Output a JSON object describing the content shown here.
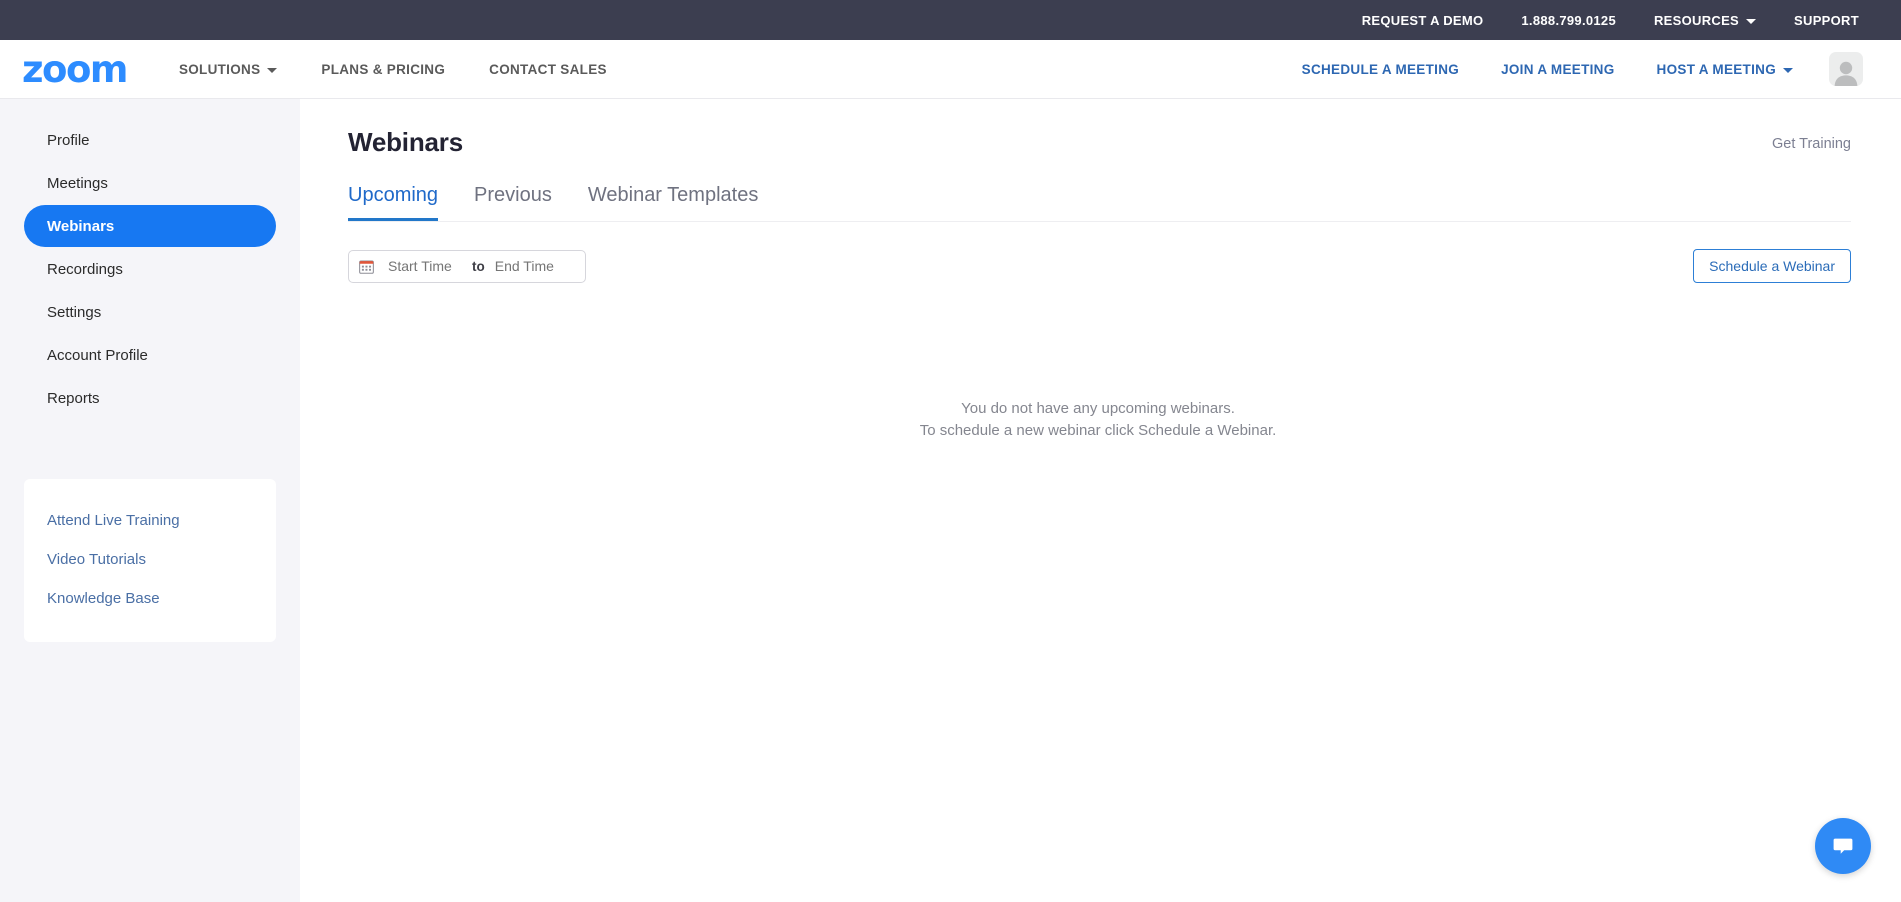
{
  "topbar": {
    "items": [
      {
        "label": "REQUEST A DEMO",
        "caret": false
      },
      {
        "label": "1.888.799.0125",
        "caret": false
      },
      {
        "label": "RESOURCES",
        "caret": true
      },
      {
        "label": "SUPPORT",
        "caret": false
      }
    ]
  },
  "mainnav": {
    "logo": "zoom",
    "left_items": [
      {
        "label": "SOLUTIONS",
        "caret": true
      },
      {
        "label": "PLANS & PRICING",
        "caret": false
      },
      {
        "label": "CONTACT SALES",
        "caret": false
      }
    ],
    "right_items": [
      {
        "label": "SCHEDULE A MEETING",
        "caret": false
      },
      {
        "label": "JOIN A MEETING",
        "caret": false
      },
      {
        "label": "HOST A MEETING",
        "caret": true
      }
    ],
    "avatar_name": "user-avatar"
  },
  "sidebar": {
    "items": [
      {
        "label": "Profile",
        "active": false
      },
      {
        "label": "Meetings",
        "active": false
      },
      {
        "label": "Webinars",
        "active": true
      },
      {
        "label": "Recordings",
        "active": false
      },
      {
        "label": "Settings",
        "active": false
      },
      {
        "label": "Account Profile",
        "active": false
      },
      {
        "label": "Reports",
        "active": false
      }
    ],
    "help_links": [
      {
        "label": "Attend Live Training"
      },
      {
        "label": "Video Tutorials"
      },
      {
        "label": "Knowledge Base"
      }
    ]
  },
  "main": {
    "page_title": "Webinars",
    "get_training": "Get Training",
    "tabs": [
      {
        "label": "Upcoming",
        "active": true
      },
      {
        "label": "Previous",
        "active": false
      },
      {
        "label": "Webinar Templates",
        "active": false
      }
    ],
    "filter": {
      "start_placeholder": "Start Time",
      "end_placeholder": "End Time",
      "start_value": "",
      "end_value": "",
      "separator": "to"
    },
    "schedule_button": "Schedule a Webinar",
    "empty_state": {
      "line1": "You do not have any upcoming webinars.",
      "line2": "To schedule a new webinar click Schedule a Webinar."
    }
  },
  "chat": {
    "icon_name": "chat-bubble-icon"
  },
  "colors": {
    "topbar_bg": "#3c3e50",
    "brand_blue": "#2d8cff",
    "sidebar_active": "#1778f2",
    "tab_active": "#2277c9",
    "link_blue": "#4a6fa5",
    "chat_blue": "#2f8af5",
    "sidebar_bg": "#f5f5f9"
  }
}
